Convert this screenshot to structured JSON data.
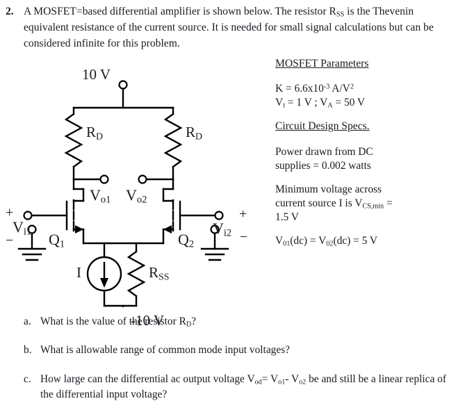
{
  "problem": {
    "number": "2.",
    "text": "A MOSFET=based differential amplifier is shown below. The resistor RSS is the Thevenin equivalent resistance of the current source. It is needed for small signal calculations but can be considered infinite for this problem.",
    "line1_a": "A MOSFET=based differential amplifier is shown below. The resistor R",
    "line1_sub": "SS",
    "line1_b": " is",
    "line2": "the Thevenin equivalent resistance of the current source. It is needed for",
    "line3": "small signal calculations but can be considered infinite for this problem."
  },
  "parameters": {
    "heading": "MOSFET Parameters",
    "k_label": "K",
    "k_eq": "  =  6.6x10",
    "k_exp": "-3",
    "k_unit": " A/V",
    "k_unit_exp": "2",
    "vt_label": "V",
    "vt_sub": "t",
    "vt_val": " = 1 V  ;  ",
    "va_label": "V",
    "va_sub": "A",
    "va_val": " = 50 V"
  },
  "specs": {
    "heading": "Circuit Design Specs.",
    "power_line1": "Power drawn from DC",
    "power_line2": "supplies = 0.002 watts",
    "minv_line1": "Minimum voltage across",
    "minv_line2a": "current source I is  V",
    "minv_sub": "CS,min",
    "minv_line2b": " =",
    "minv_line3": "1.5 V",
    "vo_line": "V01(dc) =  V02(dc) = 5 V",
    "vo_v1": "V",
    "vo_s1": "01",
    "vo_mid": "(dc) =  V",
    "vo_s2": "02",
    "vo_end": "(dc) = 5 V"
  },
  "circuit": {
    "vdd_label": "10 V",
    "vss_label": "-10 V",
    "rd_left_label": "R",
    "rd_left_sub": "D",
    "rd_right_label": "R",
    "rd_right_sub": "D",
    "vo1_label": "V",
    "vo1_sub": "o1",
    "vo2_label": "V",
    "vo2_sub": "o2",
    "q1_label": "Q",
    "q1_sub": "1",
    "q2_label": "Q",
    "q2_sub": "2",
    "vi1_label": "V",
    "vi1_sub": "i1",
    "vi2_label": "V",
    "vi2_sub": "i2",
    "current_label": "I",
    "rss_label": "R",
    "rss_sub": "SS",
    "plus_left": "+",
    "minus_left": "−",
    "plus_right": "+",
    "minus_right": "−",
    "wire_color": "#000000",
    "label_color": "#1a1a2e"
  },
  "questions": [
    {
      "label": "a.",
      "text": "What is the value of the resistor RD?",
      "part1": "What is the value of the resistor R",
      "sub1": "D",
      "part2": "?"
    },
    {
      "label": "b.",
      "text": "What is allowable range of common mode input voltages?",
      "part1": "What is allowable range of common mode input voltages?",
      "sub1": "",
      "part2": ""
    },
    {
      "label": "c.",
      "text": "How large can the differential ac output voltage Vod= Vo1- Vo2 be and still be a linear replica of the differential input voltage?",
      "part1": "How large can the differential ac output voltage V",
      "sub1": "od",
      "part2": "= V",
      "sub2": "o1",
      "part3": "- V",
      "sub3": "o2",
      "part4": " be and still",
      "line2": "be a linear replica of the differential input voltage?"
    }
  ]
}
